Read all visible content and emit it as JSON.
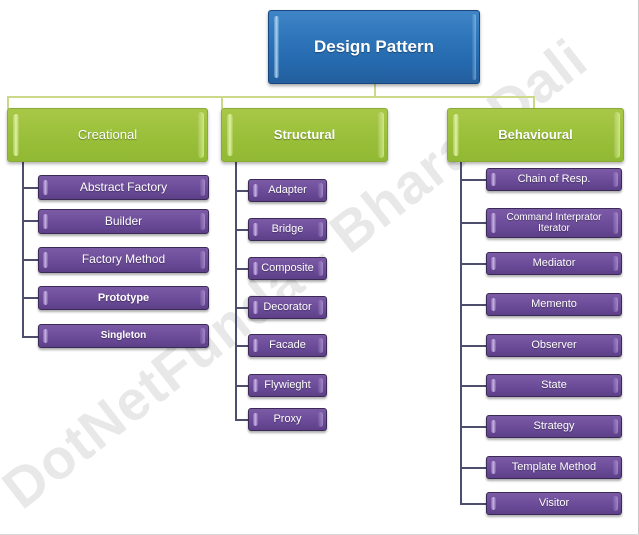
{
  "diagram": {
    "title": "Design Pattern",
    "watermark": "DotNetFunda - Bharat Dali",
    "colors": {
      "root_fill": "#2f76bb",
      "root_border": "#17477e",
      "category_fill": "#9cc13c",
      "category_border": "#8aab3a",
      "leaf_fill": "#70509c",
      "leaf_border": "#3a2a55",
      "connector_top": "#cdd98a",
      "connector": "#4d4d6e",
      "background": "#ffffff",
      "text": "#ffffff"
    }
  },
  "root": {
    "label": "Design Pattern"
  },
  "categories": [
    {
      "id": "creational",
      "label": "Creational",
      "weight": "normal",
      "patterns": [
        {
          "label": "Abstract Factory",
          "weight": "normal",
          "size": 12
        },
        {
          "label": "Builder",
          "weight": "normal",
          "size": 12
        },
        {
          "label": "Factory Method",
          "weight": "normal",
          "size": 12
        },
        {
          "label": "Prototype",
          "weight": "bold",
          "size": 11
        },
        {
          "label": "Singleton",
          "weight": "bold",
          "size": 10
        }
      ]
    },
    {
      "id": "structural",
      "label": "Structural",
      "weight": "bold",
      "patterns": [
        {
          "label": "Adapter",
          "weight": "normal",
          "size": 11
        },
        {
          "label": "Bridge",
          "weight": "normal",
          "size": 11
        },
        {
          "label": "Composite",
          "weight": "normal",
          "size": 11
        },
        {
          "label": "Decorator",
          "weight": "normal",
          "size": 11
        },
        {
          "label": "Facade",
          "weight": "normal",
          "size": 11
        },
        {
          "label": "Flywieght",
          "weight": "normal",
          "size": 11
        },
        {
          "label": "Proxy",
          "weight": "normal",
          "size": 11
        }
      ]
    },
    {
      "id": "behavioural",
      "label": "Behavioural",
      "weight": "bold",
      "patterns": [
        {
          "label": "Chain of Resp.",
          "weight": "normal",
          "size": 11
        },
        {
          "label": "Command Interprator Iterator",
          "weight": "normal",
          "size": 10
        },
        {
          "label": "Mediator",
          "weight": "normal",
          "size": 11
        },
        {
          "label": "Memento",
          "weight": "normal",
          "size": 11
        },
        {
          "label": "Observer",
          "weight": "normal",
          "size": 11
        },
        {
          "label": "State",
          "weight": "normal",
          "size": 11
        },
        {
          "label": "Strategy",
          "weight": "normal",
          "size": 11
        },
        {
          "label": "Template Method",
          "weight": "normal",
          "size": 11
        },
        {
          "label": "Visitor",
          "weight": "normal",
          "size": 11
        }
      ]
    }
  ]
}
